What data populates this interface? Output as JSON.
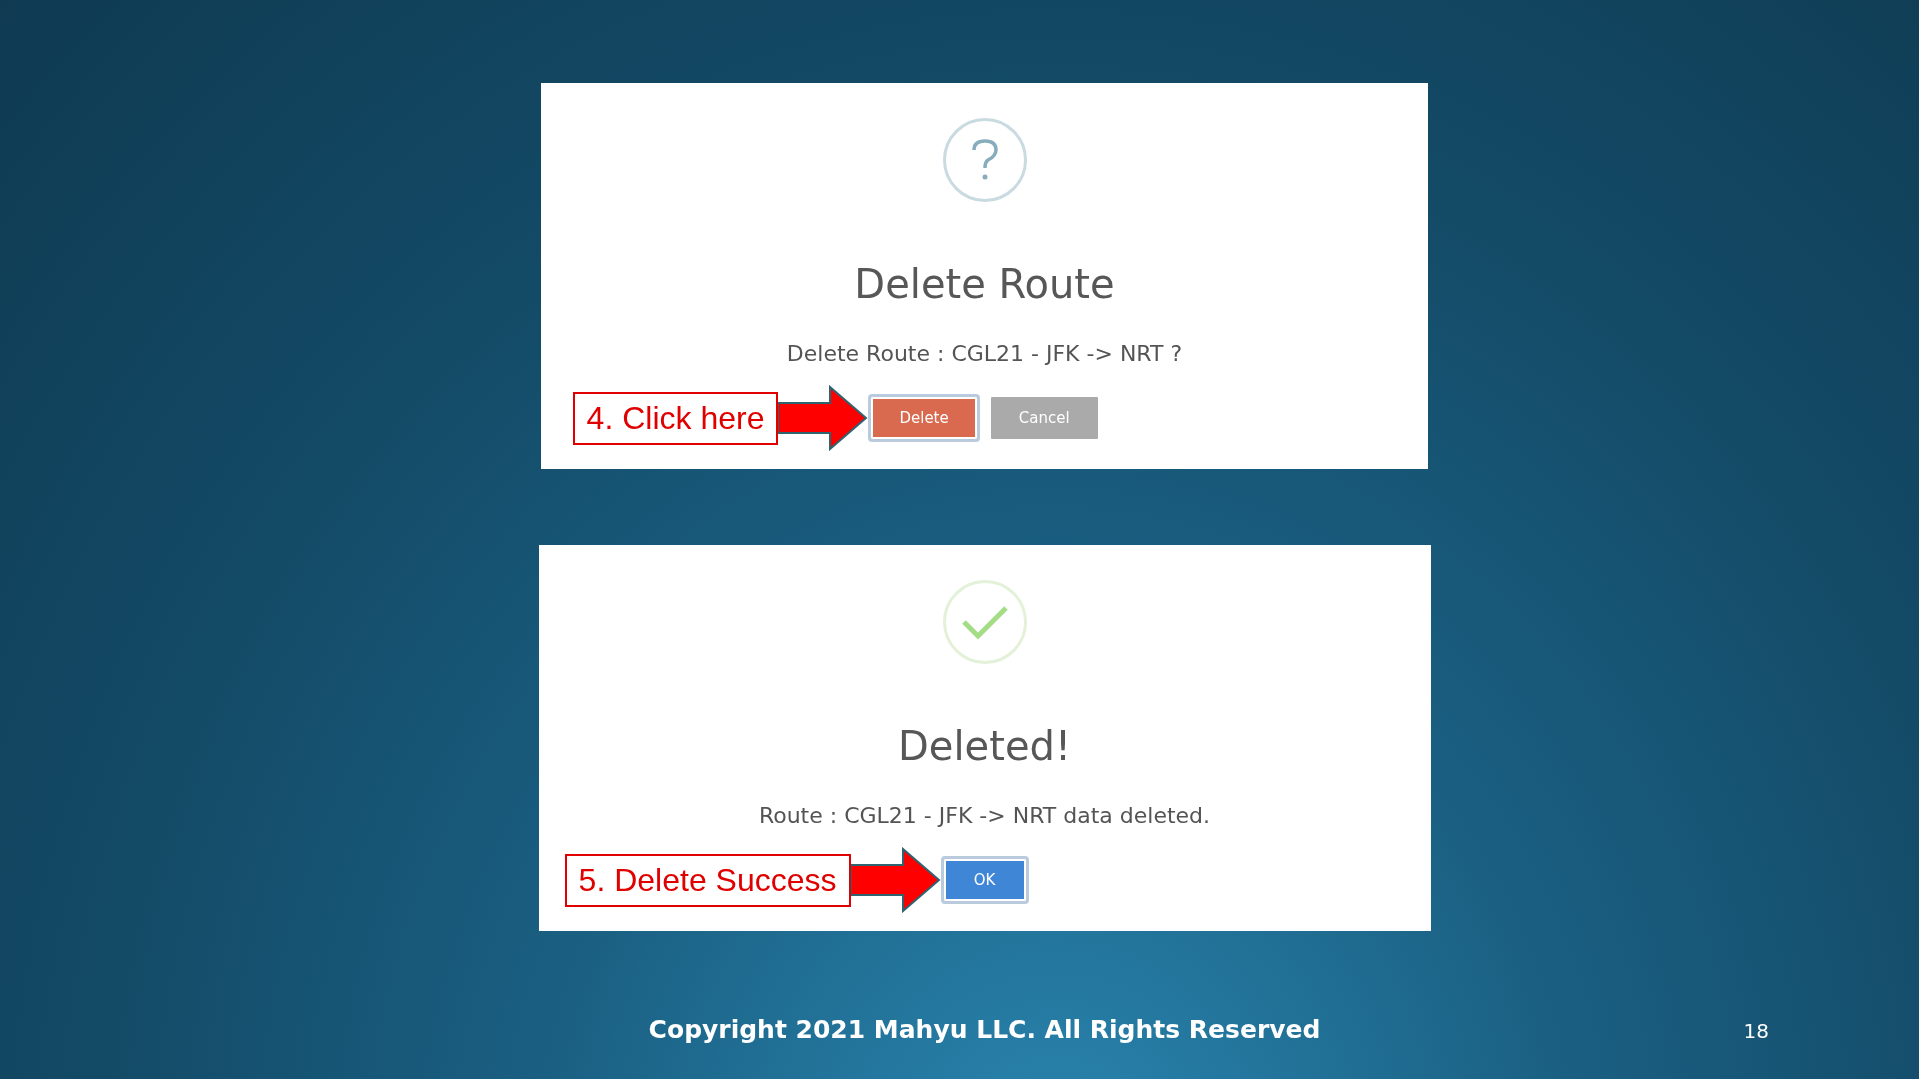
{
  "dialogs": [
    {
      "kind": "question",
      "title": "Delete Route",
      "message": "Delete Route : CGL21 - JFK -> NRT ?",
      "callout": "4. Click here",
      "buttons": [
        {
          "label": "Delete",
          "kind": "danger",
          "focused": true
        },
        {
          "label": "Cancel",
          "kind": "cancel",
          "focused": false
        }
      ]
    },
    {
      "kind": "success",
      "title": "Deleted!",
      "message": "Route : CGL21 - JFK -> NRT data deleted.",
      "callout": "5. Delete Success",
      "buttons": [
        {
          "label": "OK",
          "kind": "primary",
          "focused": true
        }
      ]
    }
  ],
  "footer": "Copyright 2021 Mahyu LLC. All Rights Reserved",
  "page_number": "18"
}
